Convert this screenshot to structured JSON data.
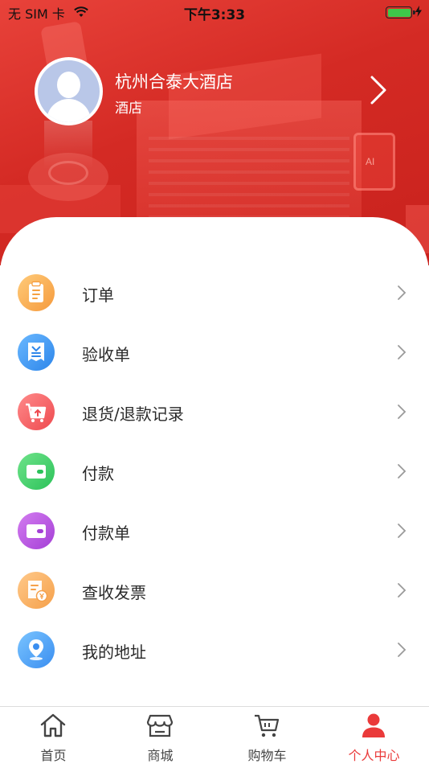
{
  "status_bar": {
    "carrier": "无 SIM 卡",
    "time": "下午3:33",
    "battery_color": "#3ec84a"
  },
  "profile": {
    "name": "杭州合泰大酒店",
    "role": "酒店",
    "avatar_icon": "default-avatar-icon",
    "arrow_icon": "chevron-right-icon"
  },
  "menu": {
    "items": [
      {
        "label": "订单",
        "icon": "order-clipboard-icon",
        "color": "#f5a040"
      },
      {
        "label": "验收单",
        "icon": "inspection-doc-icon",
        "color": "#3a8ef0"
      },
      {
        "label": "退货/退款记录",
        "icon": "return-cart-icon",
        "color": "#ef5257"
      },
      {
        "label": "付款",
        "icon": "wallet-icon",
        "color": "#33c560"
      },
      {
        "label": "付款单",
        "icon": "wallet-icon",
        "color": "#ad48dc"
      },
      {
        "label": "查收发票",
        "icon": "invoice-yen-icon",
        "color": "#f5a54e"
      },
      {
        "label": "我的地址",
        "icon": "location-pin-icon",
        "color": "#3f92f0"
      }
    ]
  },
  "tabbar": {
    "active_color": "#ea3a3a",
    "tabs": [
      {
        "label": "首页",
        "icon": "home-icon",
        "active": false
      },
      {
        "label": "商城",
        "icon": "store-icon",
        "active": false
      },
      {
        "label": "购物车",
        "icon": "cart-icon",
        "active": false
      },
      {
        "label": "个人中心",
        "icon": "person-icon",
        "active": true
      }
    ]
  }
}
